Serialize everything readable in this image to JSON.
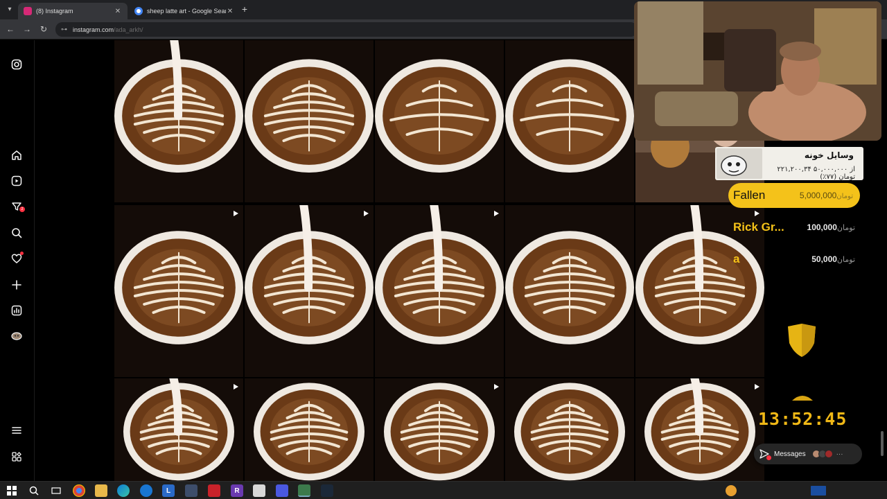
{
  "browser": {
    "tabs": [
      {
        "title": "(8) Instagram",
        "favicon_color": "#d62976",
        "active": true
      },
      {
        "title": "sheep latte art - Google Search",
        "favicon_color": "#4285f4",
        "active": false
      }
    ],
    "address": {
      "host": "instagram.com",
      "path": "/ada_arkh/"
    }
  },
  "sidebar": {
    "icons": [
      "instagram-logo-icon",
      "home-icon",
      "reels-icon",
      "explore-icon",
      "search-icon",
      "notifications-icon",
      "create-icon",
      "dashboard-icon",
      "profile-icon",
      "menu-icon",
      "threads-icon"
    ],
    "explore_badge": "2"
  },
  "grid": {
    "tiles": [
      {
        "kind": "pour",
        "reel": false
      },
      {
        "kind": "rosetta",
        "reel": false
      },
      {
        "kind": "tulip",
        "reel": false
      },
      {
        "kind": "tulip",
        "reel": false
      },
      {
        "kind": "bar",
        "reel": true
      },
      {
        "kind": "rosetta",
        "reel": true
      },
      {
        "kind": "pour",
        "reel": true
      },
      {
        "kind": "pour",
        "reel": true
      },
      {
        "kind": "rosetta",
        "reel": false
      },
      {
        "kind": "pour",
        "reel": true
      },
      {
        "kind": "pour",
        "reel": true
      },
      {
        "kind": "rosetta",
        "reel": false
      },
      {
        "kind": "rosetta",
        "reel": true
      },
      {
        "kind": "rosetta",
        "reel": false
      },
      {
        "kind": "pour",
        "reel": true
      }
    ]
  },
  "stream": {
    "goal_title": "وسایل خونه",
    "goal_progress": "۲۲۱,۲۰۰,۳۴ از ۵۰,۰۰۰,۰۰۰ تومان (۷۷٪)",
    "top_donor": {
      "name": "Fallen",
      "amount": "5,000,000",
      "currency": "تومان"
    },
    "donors": [
      {
        "name": "Rick Gr...",
        "amount": "100,000",
        "currency": "تومان"
      },
      {
        "name": "a",
        "amount": "50,000",
        "currency": "تومان"
      }
    ],
    "timer": "13:52:45"
  },
  "messages": {
    "label": "Messages"
  },
  "colors": {
    "accent_gold": "#f4c21a",
    "ig_badge": "#ff3040"
  }
}
